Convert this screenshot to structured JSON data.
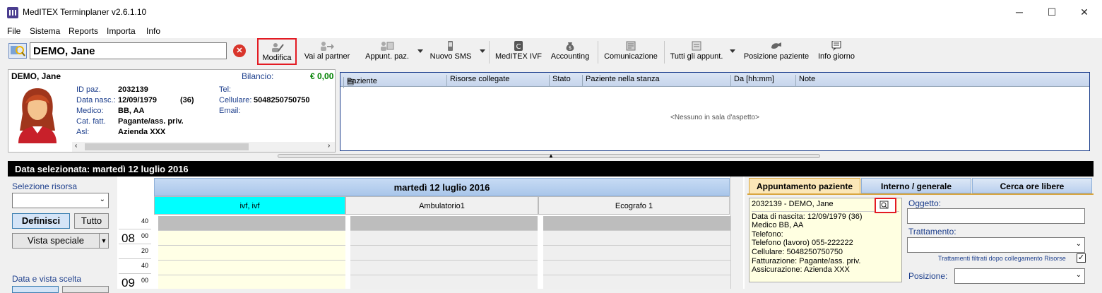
{
  "window": {
    "title": "MedITEX Terminplaner v2.6.1.10"
  },
  "menu": [
    "File",
    "Sistema",
    "Reports",
    "Importa",
    "Info"
  ],
  "patient_search": {
    "value": "DEMO, Jane"
  },
  "toolbar": {
    "modifica": "Modifica",
    "vai_al_partner": "Vai al partner",
    "appunt_paz": "Appunt. paz.",
    "nuovo_sms": "Nuovo SMS",
    "meditex_ivf": "MedITEX IVF",
    "accounting": "Accounting",
    "comunicazione": "Comunicazione",
    "tutti_appunt": "Tutti gli appunt.",
    "posizione_paziente": "Posizione paziente",
    "info_giorno": "Info giorno"
  },
  "patient": {
    "name": "DEMO, Jane",
    "bilancio_label": "Bilancio:",
    "bilancio_value": "€ 0,00",
    "labels": {
      "id": "ID paz.",
      "birth": "Data nasc.:",
      "doctor": "Medico:",
      "cat": "Cat. fatt.",
      "asl": "Asl:",
      "tel": "Tel:",
      "cell": "Cellulare:",
      "email": "Email:"
    },
    "id": "2032139",
    "birth": "12/09/1979",
    "age": "(36)",
    "doctor": "BB, AA",
    "cat": "Pagante/ass. priv.",
    "asl": "Azienda XXX",
    "tel": "",
    "cell": "5048250750750",
    "email": ""
  },
  "waiting_room": {
    "columns": [
      "Paziente",
      "Risorse collegate",
      "Stato",
      "Paziente nella stanza",
      "Da [hh:mm]",
      "Note"
    ],
    "empty_text": "<Nessuno in sala d'aspetto>"
  },
  "date_bar": {
    "text": "Data selezionata:  martedì 12 luglio 2016"
  },
  "left": {
    "selezione_risorsa": "Selezione risorsa",
    "definisci": "Definisci",
    "tutto": "Tutto",
    "vista_speciale": "Vista speciale",
    "data_vista": "Data e vista scelta"
  },
  "calendar": {
    "date_header": "martedì 12 luglio 2016",
    "resources": [
      "ivf, ivf",
      "Ambulatorio1",
      "Ecografo 1"
    ],
    "times": [
      {
        "hour": "",
        "min": "40"
      },
      {
        "hour": "08",
        "min": "00"
      },
      {
        "hour": "",
        "min": "20"
      },
      {
        "hour": "",
        "min": "40"
      },
      {
        "hour": "09",
        "min": "00"
      }
    ]
  },
  "right": {
    "tabs": [
      "Appuntamento paziente",
      "Interno / generale",
      "Cerca ore libere"
    ],
    "appt_patient": "2032139 - DEMO, Jane",
    "appt_lines": [
      "Data di nascita: 12/09/1979 (36)",
      "Medico BB, AA",
      "Telefono:",
      "Telefono (lavoro) 055-222222",
      "Cellulare: 5048250750750",
      "Fatturazione: Pagante/ass. priv.",
      "Assicurazione: Azienda XXX"
    ],
    "oggetto": "Oggetto:",
    "trattamento": "Trattamento:",
    "filter_note": "Trattamenti filtrati dopo collegamento Risorse",
    "posizione": "Posizione:"
  },
  "colors": {
    "accent_red": "#e31b23",
    "cyan_resource": "#00ffff",
    "header_blue": "#a9c6ea",
    "balance_green": "#008000"
  }
}
